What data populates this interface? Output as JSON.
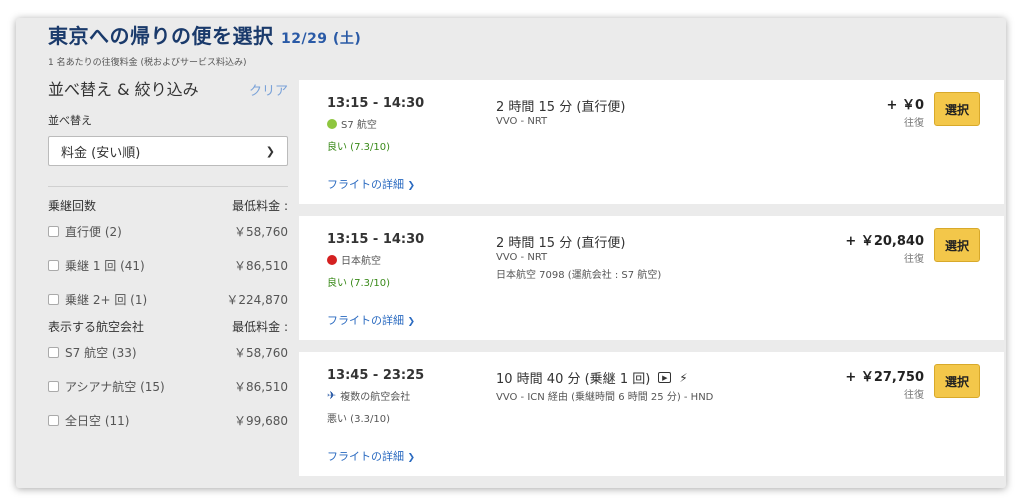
{
  "header": {
    "title": "東京への帰りの便を選択",
    "date": "12/29 (土)",
    "subtitle": "1 名あたりの往復料金 (税およびサービス料込み)"
  },
  "sidebar": {
    "title": "並べ替え & 絞り込み",
    "clear": "クリア",
    "sort_label": "並べ替え",
    "sort_value": "料金 (安い順)",
    "stops": {
      "heading": "乗継回数",
      "price_heading": "最低料金 :",
      "items": [
        {
          "label": "直行便 (2)",
          "price": "￥58,760"
        },
        {
          "label": "乗継 1 回 (41)",
          "price": "￥86,510"
        },
        {
          "label": "乗継 2+ 回 (1)",
          "price": "￥224,870"
        }
      ]
    },
    "airlines": {
      "heading": "表示する航空会社",
      "price_heading": "最低料金 :",
      "items": [
        {
          "label": "S7 航空 (33)",
          "price": "￥58,760"
        },
        {
          "label": "アシアナ航空 (15)",
          "price": "￥86,510"
        },
        {
          "label": "全日空 (11)",
          "price": "￥99,680"
        }
      ]
    }
  },
  "flights": [
    {
      "time": "13:15 - 14:30",
      "airline": "S7 航空",
      "airline_icon": "s7-logo-icon",
      "rating": "良い (7.3/10)",
      "duration": "2 時間 15 分 (直行便)",
      "route": "VVO - NRT",
      "operated": "",
      "price": "+ ￥0",
      "round": "往復",
      "select": "選択",
      "details": "フライトの詳細"
    },
    {
      "time": "13:15 - 14:30",
      "airline": "日本航空",
      "airline_icon": "jal-logo-icon",
      "rating": "良い (7.3/10)",
      "duration": "2 時間 15 分 (直行便)",
      "route": "VVO - NRT",
      "operated": "日本航空 7098 (運航会社 : S7 航空)",
      "price": "+ ￥20,840",
      "round": "往復",
      "select": "選択",
      "details": "フライトの詳細"
    },
    {
      "time": "13:45 - 23:25",
      "airline": "複数の航空会社",
      "airline_icon": "multiple-airlines-icon",
      "rating": "悪い (3.3/10)",
      "duration": "10 時間 40 分 (乗継 1 回)",
      "route": "VVO - ICN 経由 (乗継時間 6 時間 25 分) - HND",
      "operated": "",
      "price": "+ ￥27,750",
      "round": "往復",
      "select": "選択",
      "details": "フライトの詳細"
    }
  ],
  "colors": {
    "select_button": "#f3c74a",
    "link": "#2a6ac0",
    "good_rating": "#3a8a1a",
    "title": "#1a3a6b"
  }
}
